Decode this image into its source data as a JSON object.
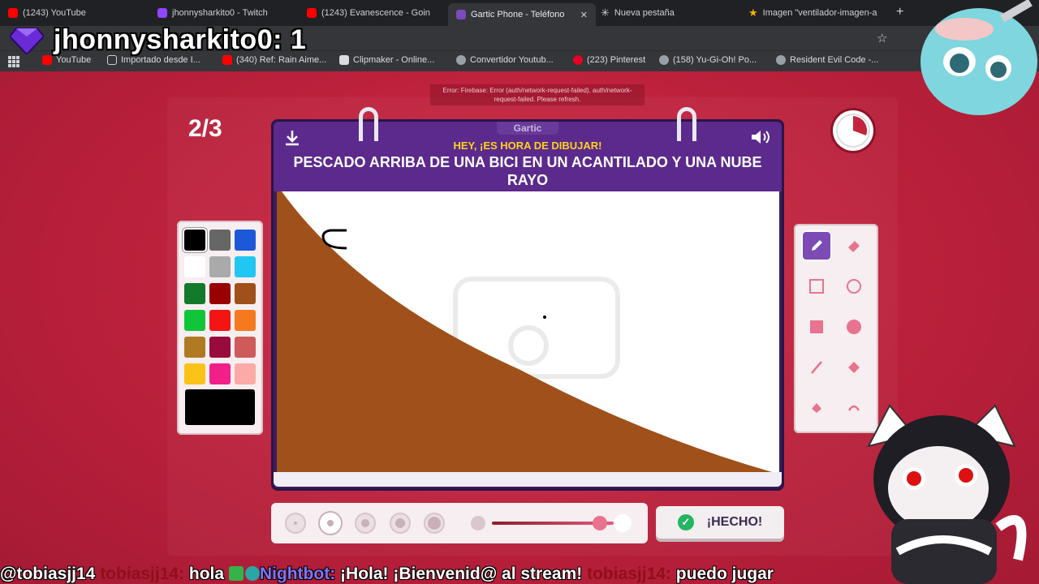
{
  "browser": {
    "tabs": [
      {
        "title": "(1243) YouTube",
        "color": "#ff0000"
      },
      {
        "title": "jhonnysharkito0 - Twitch",
        "color": "#9146ff"
      },
      {
        "title": "(1243) Evanescence - Goin",
        "color": "#ff0000"
      },
      {
        "title": "Gartic Phone - Teléfono",
        "color": "#7b4bb8",
        "active": true
      },
      {
        "title": "Nueva pestaña",
        "color": "#9aa0a6"
      },
      {
        "title": "Imagen \"ventilador-imagen-a",
        "color": "#f4b400"
      }
    ],
    "bookmarks": [
      {
        "label": "YouTube",
        "color": "#ff0000"
      },
      {
        "label": "Importado desde I...",
        "color": "#9aa0a6"
      },
      {
        "label": "(340) Ref: Rain Aime...",
        "color": "#ff0000"
      },
      {
        "label": "Clipmaker - Online...",
        "color": "#dadce0"
      },
      {
        "label": "Convertidor Youtub...",
        "color": "#9aa0a6"
      },
      {
        "label": "(223) Pinterest",
        "color": "#e60023"
      },
      {
        "label": "(158) Yu-Gi-Oh! Po...",
        "color": "#9aa0a6"
      },
      {
        "label": "Resident Evil Code -...",
        "color": "#9aa0a6"
      }
    ]
  },
  "overlay": {
    "counter": "jhonnysharkito0: 1"
  },
  "game": {
    "error": "Error: Firebase: Error (auth/network-request-failed). auth/network-request-failed. Please refresh.",
    "round": "2/3",
    "logo": "Gartic",
    "hint": "HEY, ¡ES HORA DE DIBUJAR!",
    "prompt": "PESCADO ARRIBA DE UNA BICI EN UN ACANTILADO Y UNA NUBE RAYO",
    "done_label": "¡HECHO!",
    "brush_size_index": 1,
    "colors": [
      "#000000",
      "#666666",
      "#1c58d8",
      "#ffffff",
      "#aaaaaa",
      "#22c6f2",
      "#137a2c",
      "#990000",
      "#a0501a",
      "#12c43a",
      "#f41414",
      "#f57a1f",
      "#b07a22",
      "#990b3d",
      "#cf5a5a",
      "#f9c31a",
      "#f11f8a",
      "#fbaaa8"
    ],
    "selected_color": "#000000",
    "tools": [
      "pen-icon",
      "eraser-icon",
      "rectangle-icon",
      "ellipse-icon",
      "filled-rectangle-icon",
      "filled-ellipse-icon",
      "line-icon",
      "fill-icon",
      "undo-icon",
      "redo-icon"
    ]
  },
  "chat": {
    "segments": [
      {
        "text": "@tobiasjj14 ",
        "style": "normal"
      },
      {
        "text": "tobiasjj14:",
        "style": "user-dark"
      },
      {
        "text": " hola ",
        "style": "normal"
      },
      {
        "text": "Nightbot:",
        "style": "bot"
      },
      {
        "text": " ¡Hola! ¡Bienvenid@ al stream! ",
        "style": "normal"
      },
      {
        "text": "tobiasjj14:",
        "style": "user-dark"
      },
      {
        "text": " puedo jugar",
        "style": "normal"
      }
    ]
  }
}
